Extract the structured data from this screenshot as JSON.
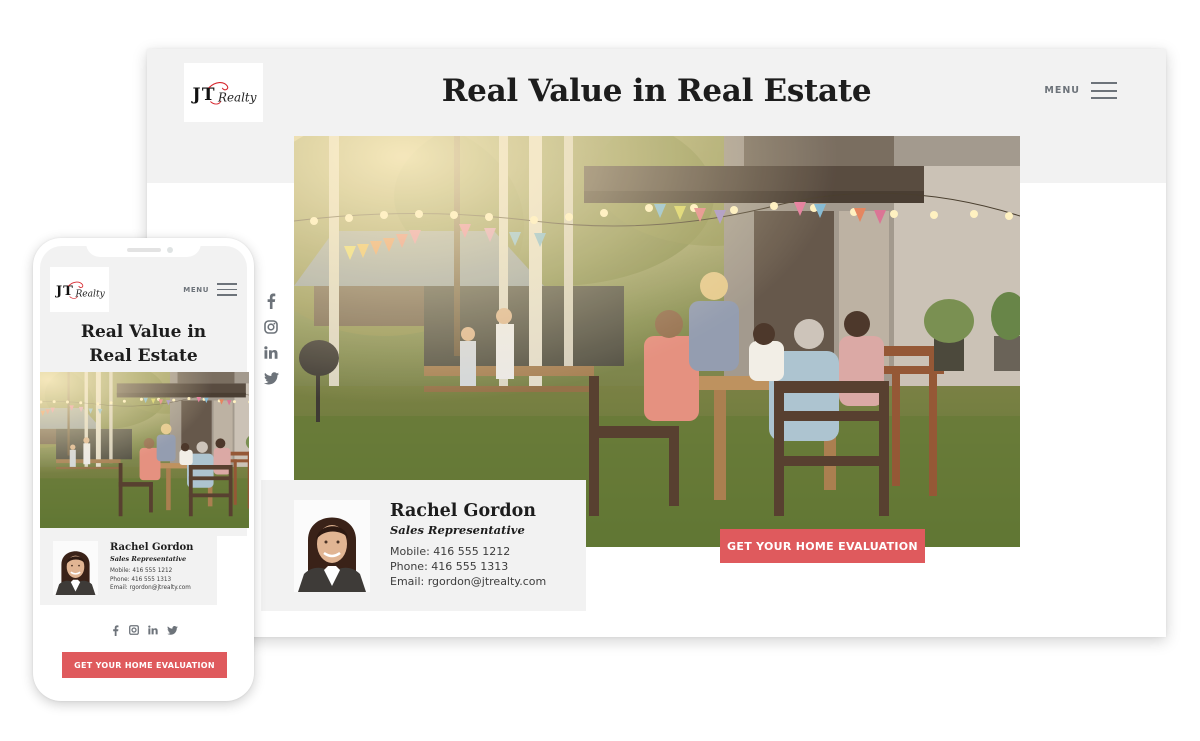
{
  "brand": {
    "logo_mark": "JT",
    "logo_script": "Realty",
    "accent_color": "#df5a5d",
    "logo_red": "#d7282f"
  },
  "desktop": {
    "header": {
      "title": "Real Value in Real Estate",
      "menu_label": "MENU",
      "menu_icon": "hamburger-icon"
    },
    "hero_image_alt": "Family dinner outdoors in backyard with string lights and bunting flags",
    "social": [
      {
        "name": "facebook",
        "icon": "facebook-icon",
        "glyph": "f"
      },
      {
        "name": "instagram",
        "icon": "instagram-icon",
        "glyph": ""
      },
      {
        "name": "linkedin",
        "icon": "linkedin-icon",
        "glyph": "in"
      },
      {
        "name": "twitter",
        "icon": "twitter-icon",
        "glyph": ""
      }
    ],
    "agent": {
      "name": "Rachel Gordon",
      "role": "Sales Representative",
      "mobile": "Mobile: 416 555 1212",
      "phone": "Phone: 416 555 1313",
      "email": "Email: rgordon@jtrealty.com"
    },
    "cta_label": "GET YOUR HOME EVALUATION"
  },
  "mobile": {
    "header": {
      "title_line1": "Real Value in",
      "title_line2": "Real Estate",
      "menu_label": "MENU"
    },
    "agent": {
      "name": "Rachel Gordon",
      "role": "Sales Representative",
      "mobile": "Mobile: 416 555 1212",
      "phone": "Phone: 416 555 1313",
      "email": "Email: rgordon@jtrealty.com"
    },
    "social": [
      {
        "name": "facebook",
        "glyph": "f"
      },
      {
        "name": "instagram",
        "glyph": ""
      },
      {
        "name": "linkedin",
        "glyph": "in"
      },
      {
        "name": "twitter",
        "glyph": ""
      }
    ],
    "cta_label": "GET YOUR HOME EVALUATION"
  }
}
